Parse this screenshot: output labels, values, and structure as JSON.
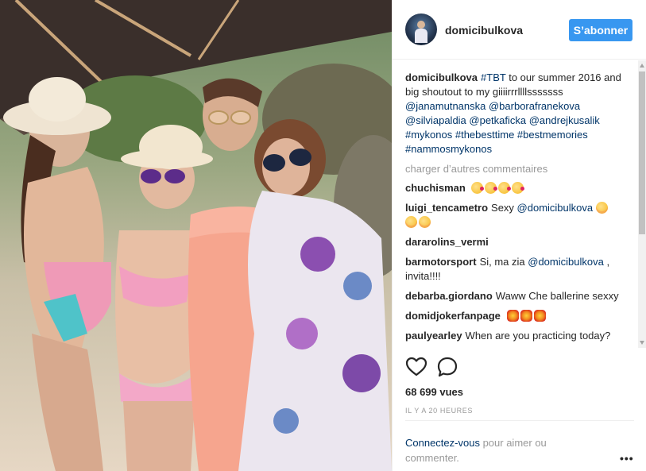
{
  "post": {
    "username": "domicibulkova",
    "follow_label": "S’abonner"
  },
  "caption": {
    "username": "domicibulkova",
    "hashtag1": "#TBT",
    "text1": " to our summer 2016 and big shoutout to my giiiirrrllllsssssss ",
    "mentions": "@janamutnanska @barborafranekova @silviapaldia @petkaficka @andrejkusalik",
    "hashtags": "#mykonos #thebesttime #bestmemories #nammosmykonos"
  },
  "load_more_label": "charger d’autres commentaires",
  "comments": [
    {
      "username": "chuchisman",
      "text": ""
    },
    {
      "username": "luigi_tencametro",
      "text": "Sexy ",
      "mention": "@domicibulkova"
    },
    {
      "username": "dararolins_vermi",
      "text": ""
    },
    {
      "username": "barmotorsport",
      "text": "Si, ma zia ",
      "mention": "@domicibulkova",
      "text_after": " , invita!!!!"
    },
    {
      "username": "debarba.giordano",
      "text": "Waww Che ballerine sexxy"
    },
    {
      "username": "domidjokerfanpage",
      "text": ""
    },
    {
      "username": "paulyearley",
      "text": "When are you practicing today?"
    }
  ],
  "icons": {
    "like": "heart-icon",
    "comment": "comment-bubble-icon",
    "more": "more-options-icon"
  },
  "stats": {
    "views": "68 699 vues",
    "timestamp": "IL Y A 20 HEURES"
  },
  "login_prompt": {
    "link": "Connectez-vous",
    "text": " pour aimer ou commenter."
  },
  "more_label": "•••",
  "colors": {
    "accent": "#3897f0",
    "link": "#003569",
    "muted": "#999999"
  }
}
